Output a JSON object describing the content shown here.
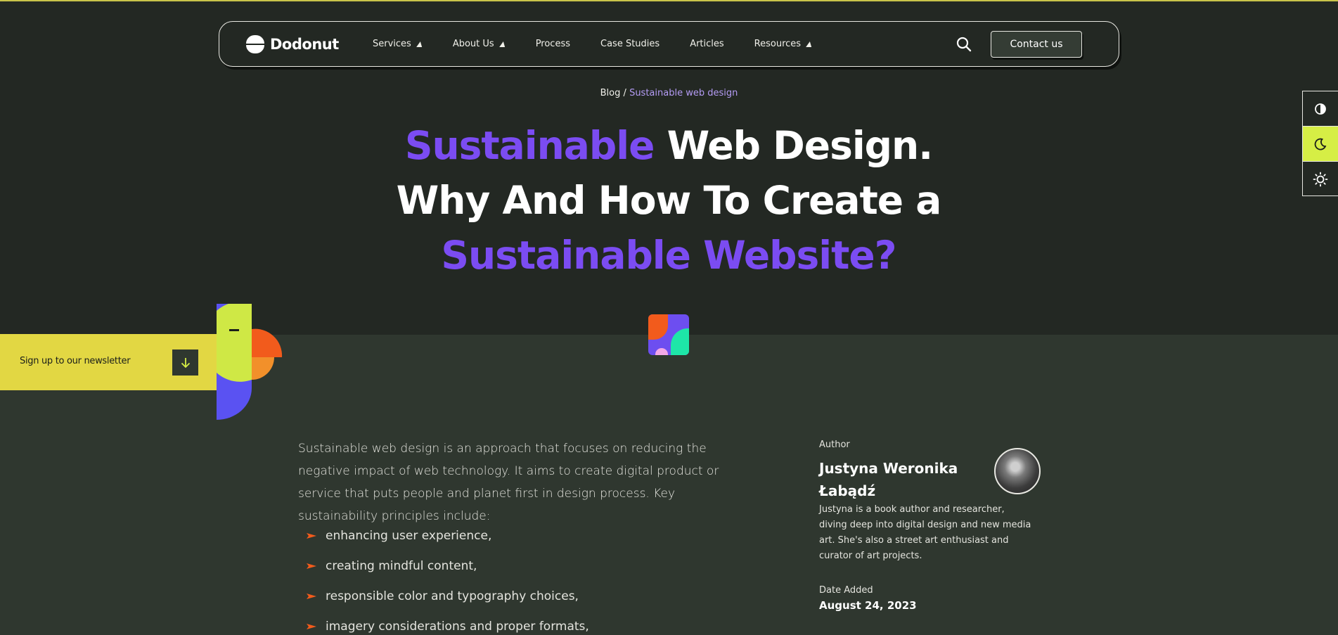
{
  "nav": {
    "logo_text": "Dodonut",
    "items": [
      {
        "label": "Services",
        "has_dropdown": true
      },
      {
        "label": "About Us",
        "has_dropdown": true
      },
      {
        "label": "Process",
        "has_dropdown": false
      },
      {
        "label": "Case Studies",
        "has_dropdown": false
      },
      {
        "label": "Articles",
        "has_dropdown": false
      },
      {
        "label": "Resources",
        "has_dropdown": true
      }
    ],
    "search_icon": "search-icon",
    "contact_label": "Contact us"
  },
  "breadcrumb": {
    "root": "Blog",
    "separator": "/",
    "current": "Sustainable web design"
  },
  "title": {
    "line1_accent": "Sustainable",
    "line1_rest": " Web Design.",
    "line2": "Why And How To Create a",
    "line3_accent": "Sustainable Website?"
  },
  "newsletter": {
    "label": "Sign up to our newsletter",
    "button_icon": "arrow-down-icon"
  },
  "theme_switcher": {
    "options": [
      "contrast-icon",
      "moon-icon",
      "sun-icon"
    ],
    "active": "moon-icon"
  },
  "article": {
    "intro": "Sustainable web design is an approach that focuses on reducing the negative impact of web technology. It aims to create digital product or service that puts people and planet first in design process. Key sustainability principles include:",
    "principles": [
      "enhancing user experience,",
      "creating mindful content,",
      "responsible color and typography choices,",
      "imagery considerations and proper formats,"
    ]
  },
  "author": {
    "label": "Author",
    "name": "Justyna Weronika Łabądź",
    "bio": "Justyna is a book author and researcher, diving deep into digital design and new media art. She's also a street art enthusiast and curator of art projects.",
    "date_label": "Date Added",
    "date_value": "August 24, 2023"
  },
  "colors": {
    "background": "#232823",
    "section_background": "#2f372f",
    "accent_purple": "#7b4cf2",
    "newsletter_yellow": "#e2d743",
    "active_theme": "#d6ee45",
    "bullet_orange": "#f25b1c"
  }
}
